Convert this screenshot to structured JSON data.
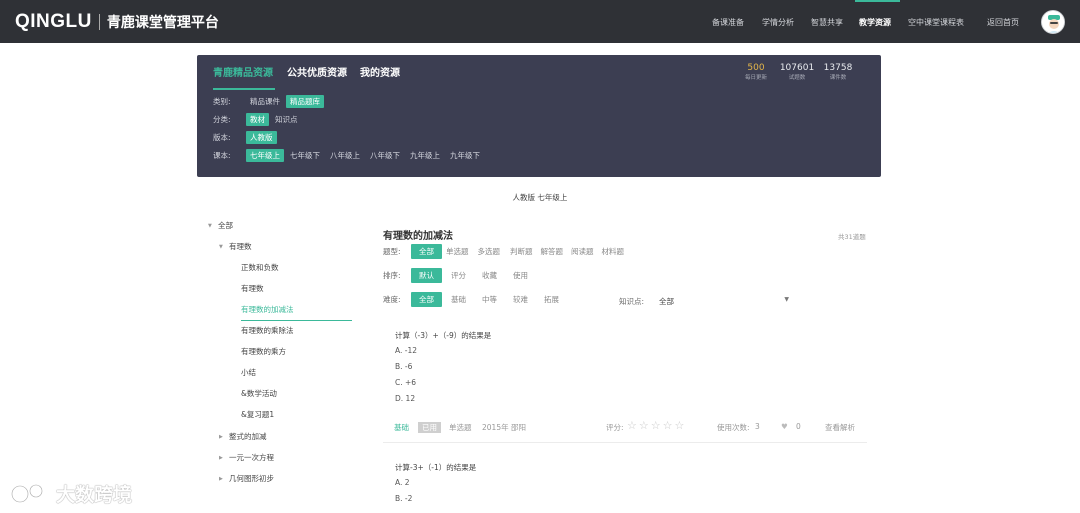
{
  "header": {
    "logo": "QINGLU",
    "title": "青鹿课堂管理平台",
    "nav": [
      "备课准备",
      "学情分析",
      "智慧共享",
      "教学资源",
      "空中课堂课程表",
      "返回首页"
    ],
    "active_nav": "教学资源"
  },
  "resource_panel": {
    "tabs": [
      "青鹿精品资源",
      "公共优质资源",
      "我的资源"
    ],
    "active_tab": "青鹿精品资源",
    "stats": [
      {
        "value": "500",
        "label": "每日更新"
      },
      {
        "value": "107601",
        "label": "试题数"
      },
      {
        "value": "13758",
        "label": "课件数"
      }
    ],
    "filters": [
      {
        "label": "类别:",
        "options": [
          "精品课件",
          "精品题库"
        ],
        "selected": "精品题库"
      },
      {
        "label": "分类:",
        "options": [
          "教材",
          "知识点"
        ],
        "selected": "教材"
      },
      {
        "label": "版本:",
        "options": [
          "人教版"
        ],
        "selected": "人教版"
      },
      {
        "label": "课本:",
        "options": [
          "七年级上",
          "七年级下",
          "八年级上",
          "八年级下",
          "九年级上",
          "九年级下"
        ],
        "selected": "七年级上"
      }
    ]
  },
  "breadcrumb": "人教版 七年级上",
  "tree": {
    "root": "全部",
    "chapter": "有理数",
    "sections": [
      "正数和负数",
      "有理数",
      "有理数的加减法",
      "有理数的乘除法",
      "有理数的乘方",
      "小结",
      "&数学活动",
      "&复习题1"
    ],
    "active_section": "有理数的加减法",
    "collapsed_chapters": [
      "整式的加减",
      "一元一次方程",
      "几何图形初步"
    ]
  },
  "main": {
    "title": "有理数的加减法",
    "total": "共31道题",
    "filters": [
      {
        "label": "题型:",
        "options": [
          "全部",
          "单选题",
          "多选题",
          "判断题",
          "解答题",
          "阅读题",
          "材料题"
        ],
        "selected": "全部"
      },
      {
        "label": "排序:",
        "options": [
          "默认",
          "评分",
          "收藏",
          "使用"
        ],
        "selected": "默认"
      },
      {
        "label": "难度:",
        "options": [
          "全部",
          "基础",
          "中等",
          "较难",
          "拓展"
        ],
        "selected": "全部"
      }
    ],
    "knowledge_label": "知识点:",
    "knowledge_value": "全部",
    "questions": [
      {
        "text": "计算（-3）+（-9）的结果是",
        "options": [
          "A.  -12",
          "B.  -6",
          "C.  +6",
          "D.  12"
        ],
        "difficulty": "基础",
        "tag": "已用",
        "type": "单选题",
        "source": "2015年 邵阳",
        "rating_label": "评分:",
        "rating": 0,
        "uses_label": "使用次数:",
        "uses": "3",
        "likes": "0",
        "view_label": "查看解析"
      },
      {
        "text": "计算-3+（-1）的结果是",
        "options": [
          "A.  2",
          "B.  -2"
        ]
      }
    ]
  },
  "watermark": "大数跨境",
  "colors": {
    "accent": "#3bb99a",
    "topbar": "#2f3136",
    "panel": "#3c3e52",
    "highlight": "#e4b64a"
  }
}
